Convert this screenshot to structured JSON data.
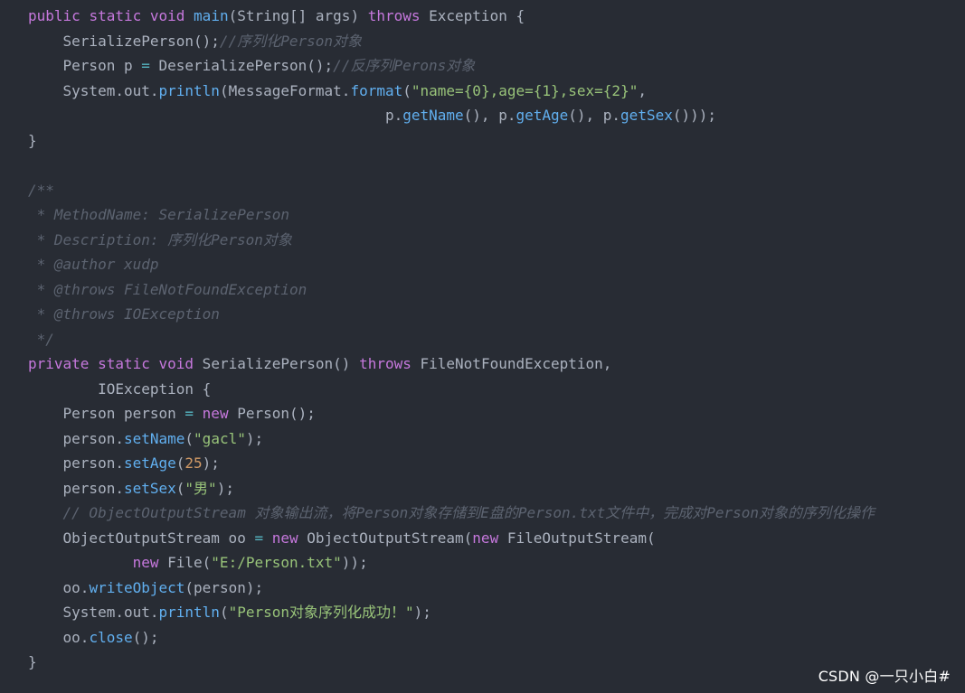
{
  "colors": {
    "background": "#282c34",
    "plain": "#abb2bf",
    "keyword": "#c678dd",
    "function": "#61afef",
    "string": "#98c379",
    "number": "#d19a66",
    "operator": "#56b6c2",
    "comment": "#5c6370"
  },
  "code": {
    "lines": [
      [
        {
          "t": "kw",
          "v": "public"
        },
        {
          "t": "pl",
          "v": " "
        },
        {
          "t": "kw",
          "v": "static"
        },
        {
          "t": "pl",
          "v": " "
        },
        {
          "t": "kw",
          "v": "void"
        },
        {
          "t": "pl",
          "v": " "
        },
        {
          "t": "fn",
          "v": "main"
        },
        {
          "t": "pl",
          "v": "(String[] args) "
        },
        {
          "t": "kw",
          "v": "throws"
        },
        {
          "t": "pl",
          "v": " Exception {"
        }
      ],
      [
        {
          "t": "pl",
          "v": "    SerializePerson();"
        },
        {
          "t": "cm",
          "v": "//序列化Person对象"
        }
      ],
      [
        {
          "t": "pl",
          "v": "    Person p "
        },
        {
          "t": "op",
          "v": "="
        },
        {
          "t": "pl",
          "v": " DeserializePerson();"
        },
        {
          "t": "cm",
          "v": "//反序列Perons对象"
        }
      ],
      [
        {
          "t": "pl",
          "v": "    System.out."
        },
        {
          "t": "fn",
          "v": "println"
        },
        {
          "t": "pl",
          "v": "(MessageFormat."
        },
        {
          "t": "fn",
          "v": "format"
        },
        {
          "t": "pl",
          "v": "("
        },
        {
          "t": "str",
          "v": "\"name={0},age={1},sex={2}\""
        },
        {
          "t": "pl",
          "v": ","
        }
      ],
      [
        {
          "t": "pl",
          "v": "                                         p."
        },
        {
          "t": "fn",
          "v": "getName"
        },
        {
          "t": "pl",
          "v": "(), p."
        },
        {
          "t": "fn",
          "v": "getAge"
        },
        {
          "t": "pl",
          "v": "(), p."
        },
        {
          "t": "fn",
          "v": "getSex"
        },
        {
          "t": "pl",
          "v": "()));"
        }
      ],
      [
        {
          "t": "pl",
          "v": "}"
        }
      ],
      [],
      [
        {
          "t": "cm",
          "v": "/**"
        }
      ],
      [
        {
          "t": "cm",
          "v": " * MethodName: SerializePerson"
        }
      ],
      [
        {
          "t": "cm",
          "v": " * Description: 序列化Person对象"
        }
      ],
      [
        {
          "t": "cm",
          "v": " * @author xudp"
        }
      ],
      [
        {
          "t": "cm",
          "v": " * @throws FileNotFoundException"
        }
      ],
      [
        {
          "t": "cm",
          "v": " * @throws IOException"
        }
      ],
      [
        {
          "t": "cm",
          "v": " */"
        }
      ],
      [
        {
          "t": "kw",
          "v": "private"
        },
        {
          "t": "pl",
          "v": " "
        },
        {
          "t": "kw",
          "v": "static"
        },
        {
          "t": "pl",
          "v": " "
        },
        {
          "t": "kw",
          "v": "void"
        },
        {
          "t": "pl",
          "v": " SerializePerson() "
        },
        {
          "t": "kw",
          "v": "throws"
        },
        {
          "t": "pl",
          "v": " FileNotFoundException,"
        }
      ],
      [
        {
          "t": "pl",
          "v": "        IOException {"
        }
      ],
      [
        {
          "t": "pl",
          "v": "    Person person "
        },
        {
          "t": "op",
          "v": "="
        },
        {
          "t": "pl",
          "v": " "
        },
        {
          "t": "kw",
          "v": "new"
        },
        {
          "t": "pl",
          "v": " Person();"
        }
      ],
      [
        {
          "t": "pl",
          "v": "    person."
        },
        {
          "t": "fn",
          "v": "setName"
        },
        {
          "t": "pl",
          "v": "("
        },
        {
          "t": "str",
          "v": "\"gacl\""
        },
        {
          "t": "pl",
          "v": ");"
        }
      ],
      [
        {
          "t": "pl",
          "v": "    person."
        },
        {
          "t": "fn",
          "v": "setAge"
        },
        {
          "t": "pl",
          "v": "("
        },
        {
          "t": "num",
          "v": "25"
        },
        {
          "t": "pl",
          "v": ");"
        }
      ],
      [
        {
          "t": "pl",
          "v": "    person."
        },
        {
          "t": "fn",
          "v": "setSex"
        },
        {
          "t": "pl",
          "v": "("
        },
        {
          "t": "str",
          "v": "\"男\""
        },
        {
          "t": "pl",
          "v": ");"
        }
      ],
      [
        {
          "t": "cm",
          "v": "    // ObjectOutputStream 对象输出流，将Person对象存储到E盘的Person.txt文件中，完成对Person对象的序列化操作"
        }
      ],
      [
        {
          "t": "pl",
          "v": "    ObjectOutputStream oo "
        },
        {
          "t": "op",
          "v": "="
        },
        {
          "t": "pl",
          "v": " "
        },
        {
          "t": "kw",
          "v": "new"
        },
        {
          "t": "pl",
          "v": " ObjectOutputStream("
        },
        {
          "t": "kw",
          "v": "new"
        },
        {
          "t": "pl",
          "v": " FileOutputStream("
        }
      ],
      [
        {
          "t": "pl",
          "v": "            "
        },
        {
          "t": "kw",
          "v": "new"
        },
        {
          "t": "pl",
          "v": " File("
        },
        {
          "t": "str",
          "v": "\"E:/Person.txt\""
        },
        {
          "t": "pl",
          "v": "));"
        }
      ],
      [
        {
          "t": "pl",
          "v": "    oo."
        },
        {
          "t": "fn",
          "v": "writeObject"
        },
        {
          "t": "pl",
          "v": "(person);"
        }
      ],
      [
        {
          "t": "pl",
          "v": "    System.out."
        },
        {
          "t": "fn",
          "v": "println"
        },
        {
          "t": "pl",
          "v": "("
        },
        {
          "t": "str",
          "v": "\"Person对象序列化成功！\""
        },
        {
          "t": "pl",
          "v": ");"
        }
      ],
      [
        {
          "t": "pl",
          "v": "    oo."
        },
        {
          "t": "fn",
          "v": "close"
        },
        {
          "t": "pl",
          "v": "();"
        }
      ],
      [
        {
          "t": "pl",
          "v": "}"
        }
      ]
    ]
  },
  "watermark": {
    "text": "CSDN @一只小白#"
  }
}
